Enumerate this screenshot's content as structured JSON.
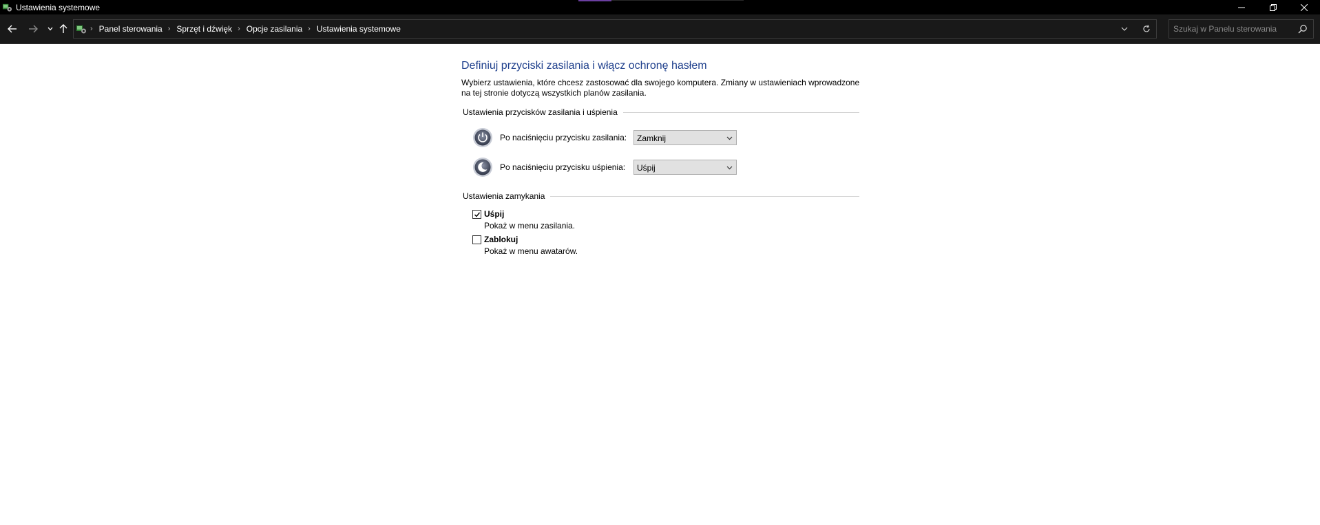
{
  "window": {
    "title": "Ustawienia systemowe"
  },
  "nav": {
    "breadcrumbs": [
      {
        "label": "Panel sterowania"
      },
      {
        "label": "Sprzęt i dźwięk"
      },
      {
        "label": "Opcje zasilania"
      },
      {
        "label": "Ustawienia systemowe"
      }
    ],
    "search_placeholder": "Szukaj w Panelu sterowania"
  },
  "page": {
    "title": "Definiuj przyciski zasilania i włącz ochronę hasłem",
    "description": "Wybierz ustawienia, które chcesz zastosować dla swojego komputera. Zmiany w ustawieniach wprowadzone na tej stronie dotyczą wszystkich planów zasilania.",
    "power_section": {
      "heading": "Ustawienia przycisków zasilania i uśpienia",
      "power_button": {
        "label": "Po naciśnięciu przycisku zasilania:",
        "value": "Zamknij",
        "icon": "power-button-icon"
      },
      "sleep_button": {
        "label": "Po naciśnięciu przycisku uśpienia:",
        "value": "Uśpij",
        "icon": "sleep-button-icon"
      }
    },
    "shutdown_section": {
      "heading": "Ustawienia zamykania",
      "options": [
        {
          "label": "Uśpij",
          "description": "Pokaż w menu zasilania.",
          "checked": true
        },
        {
          "label": "Zablokuj",
          "description": "Pokaż w menu awatarów.",
          "checked": false
        }
      ]
    }
  },
  "colors": {
    "title_blue": "#1e3f8c",
    "chrome_dark": "#191919"
  }
}
